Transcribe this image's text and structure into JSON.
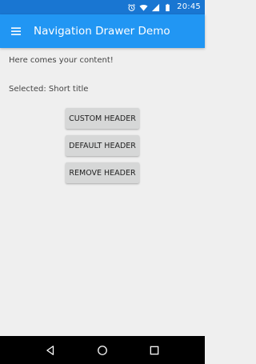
{
  "status_bar": {
    "time": "20:45",
    "icons": [
      "alarm-icon",
      "wifi-icon",
      "signal-icon",
      "battery-icon"
    ]
  },
  "app_bar": {
    "title": "Navigation Drawer Demo",
    "menu_icon": "hamburger-menu-icon",
    "background_color": "#2196f3",
    "status_color": "#1976d2"
  },
  "content": {
    "intro_text": "Here comes your content!",
    "selected_text": "Selected: Short title",
    "buttons": [
      {
        "label": "CUSTOM HEADER"
      },
      {
        "label": "DEFAULT HEADER"
      },
      {
        "label": "REMOVE HEADER"
      }
    ]
  },
  "nav_bar": {
    "buttons": [
      "back-icon",
      "home-icon",
      "recents-icon"
    ]
  }
}
